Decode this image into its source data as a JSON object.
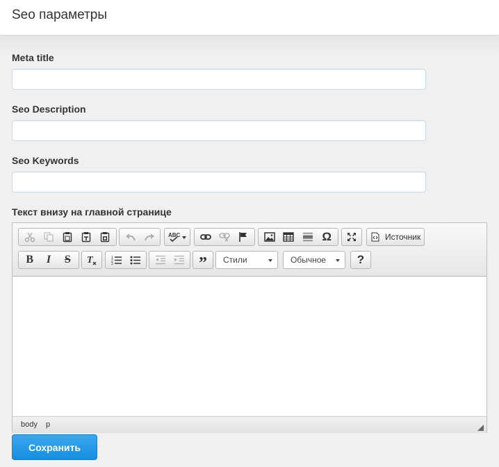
{
  "header": {
    "title": "Seo параметры"
  },
  "form": {
    "meta_title": {
      "label": "Meta title",
      "value": ""
    },
    "seo_description": {
      "label": "Seo Description",
      "value": ""
    },
    "seo_keywords": {
      "label": "Seo Keywords",
      "value": ""
    },
    "bottom_text": {
      "label": "Текст внизу на главной странице"
    }
  },
  "editor": {
    "toolbar": {
      "row1": [
        [
          "cut-icon",
          "copy-icon",
          "paste-icon",
          "paste-text-icon",
          "paste-word-icon"
        ],
        [
          "undo-icon",
          "redo-icon"
        ],
        [
          "spellcheck-icon"
        ],
        [
          "link-icon",
          "unlink-icon",
          "anchor-flag-icon"
        ],
        [
          "image-icon",
          "table-icon",
          "horizontal-rule-icon",
          "special-char-icon"
        ],
        [
          "maximize-icon"
        ],
        [
          "source-icon"
        ]
      ],
      "source_label": "Источник",
      "row2": [
        [
          "bold-icon",
          "italic-icon",
          "strike-icon"
        ],
        [
          "remove-format-icon"
        ],
        [
          "numbered-list-icon",
          "bulleted-list-icon"
        ],
        [
          "outdent-icon",
          "indent-icon"
        ],
        [
          "blockquote-icon"
        ],
        [
          "help-icon"
        ]
      ],
      "styles_combo": "Стили",
      "format_combo": "Обычное",
      "help_label": "?"
    },
    "content": "",
    "elements_path": [
      "body",
      "p"
    ]
  },
  "actions": {
    "save_label": "Сохранить"
  },
  "colors": {
    "accent": "#2196e8",
    "input_border": "#c6dcee"
  }
}
